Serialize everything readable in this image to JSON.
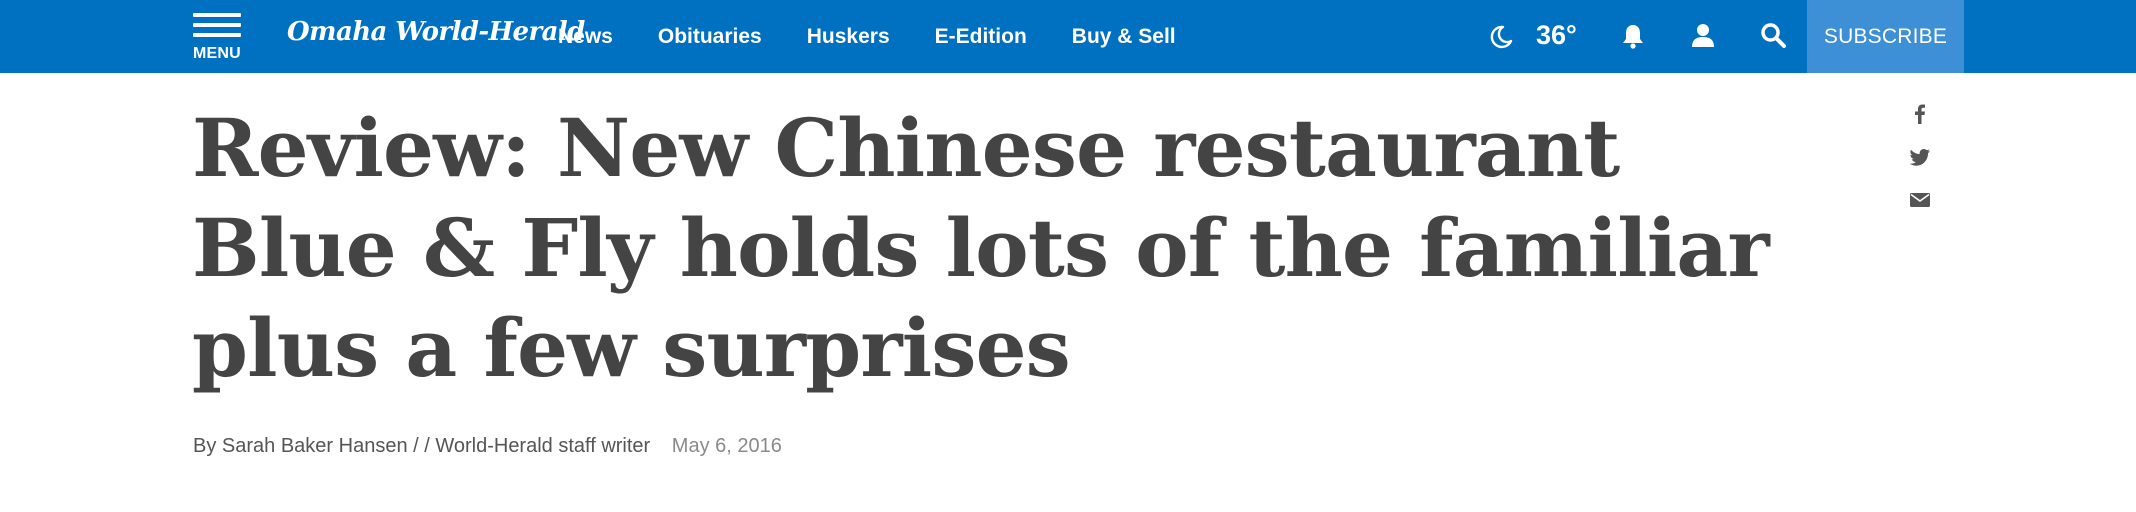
{
  "header": {
    "menu_label": "MENU",
    "logo_text": "Omaha World-Herald",
    "nav": [
      "News",
      "Obituaries",
      "Huskers",
      "E-Edition",
      "Buy & Sell"
    ],
    "weather_icon": "moon-icon",
    "temperature": "36°",
    "subscribe_label": "SUBSCRIBE",
    "brand_color": "#0070c0",
    "subscribe_color": "#3d8fd6"
  },
  "article": {
    "headline": "Review: New Chinese restaurant Blue & Fly holds lots of the familiar plus a few surprises",
    "byline": "By Sarah Baker Hansen / / World-Herald staff writer",
    "date": "May 6, 2016",
    "text_color": "#444444"
  },
  "share": {
    "icons": [
      "facebook-icon",
      "twitter-icon",
      "email-icon"
    ]
  }
}
